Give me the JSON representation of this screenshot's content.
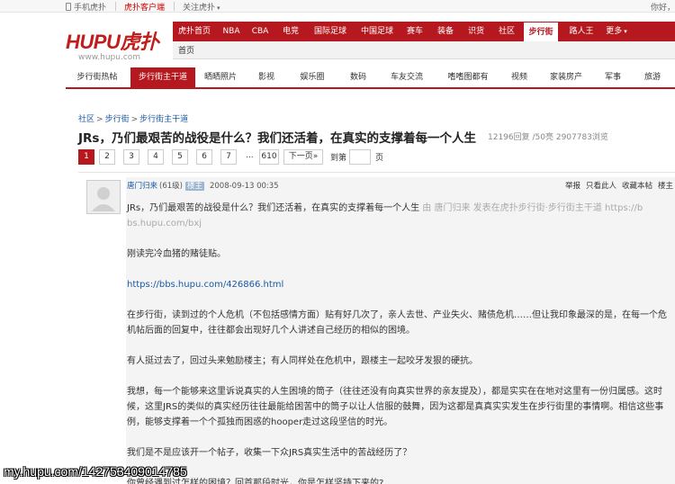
{
  "topbar": {
    "mobile": "手机虎扑",
    "client": "虎扑客户端",
    "follow": "关注虎扑",
    "hello": "你好，"
  },
  "header": {
    "logo_text": "HUPU虎扑",
    "logo_url": "www.hupu.com"
  },
  "mainnav": {
    "items": [
      "虎扑首页",
      "NBA",
      "CBA",
      "电竞",
      "国际足球",
      "中国足球",
      "赛车",
      "装备",
      "识货",
      "社区",
      "步行街",
      "路人王",
      "更多"
    ],
    "active_index": 10,
    "sub_item": "首页"
  },
  "channels": {
    "items": [
      "步行街热帖",
      "步行街主干道",
      "晒晒照片",
      "影视",
      "娱乐圈",
      "数码",
      "车友交流",
      "嗜嗜图都有",
      "视频",
      "家装房产",
      "军事",
      "旅游"
    ],
    "active_index": 1
  },
  "breadcrumb": [
    "社区",
    "步行街",
    "步行街主干道"
  ],
  "thread": {
    "title": "JRs，乃们最艰苦的战役是什么？我们还活着，在真实的支撑着每一个人生",
    "stats": "12196回复 /50亮  2907783浏览"
  },
  "pager": {
    "pages": [
      "1",
      "2",
      "3",
      "4",
      "5",
      "6",
      "7"
    ],
    "ellipsis": "...",
    "last": "610",
    "next": "下一页»",
    "goto_label": "到第",
    "page_unit": "页"
  },
  "post": {
    "author": "唐门归来",
    "level": "(61级)",
    "badge": "楼主",
    "time": "2008-09-13 00:35",
    "actions": [
      "举报",
      "只看此人",
      "收藏本帖",
      "楼主"
    ],
    "line1": "JRs，乃们最艰苦的战役是什么？我们还活着，在真实的支撑着每一个人生",
    "line1_source": " 由 唐门归来 发表在虎扑步行街·步行街主干道 https://b",
    "line1_cont": "bs.hupu.com/bxj",
    "p1": "刚读完冷血猪的赌徒贴。",
    "link": "https://bbs.hupu.com/426866.html",
    "p2": "在步行街，读到过的个人危机（不包括感情方面）贴有好几次了，亲人去世、产业失火、赌债危机……但让我印象最深的是，在每一个危机帖后面的回复中，往往都会出现好几个人讲述自己经历的相似的困境。",
    "p3": "有人挺过去了，回过头来勉励楼主；有人同样处在危机中，跟楼主一起咬牙发狠的硬抗。",
    "p4": "我想，每一个能够来这里诉说真实的人生困境的筒子（往往还没有向真实世界的亲友提及），都是实实在在地对这里有一份归属感。这时候，这里JRS的类似的真实经历往往最能给困苦中的筒子以让人信服的鼓舞，因为这都是真真实实发生在步行街里的事情啊。相信这些事例，能够支撑着一个个孤独而困惑的hooper走过这段坚信的时光。",
    "p5": "我们是不是应该开一个帖子，收集一下众JRS真实生活中的苦战经历了？",
    "p6": "你曾经遇到过怎样的困境？回首那段时光，你是怎样坚持下来的?"
  },
  "watermark": "my.hupu.com/142753409014785"
}
